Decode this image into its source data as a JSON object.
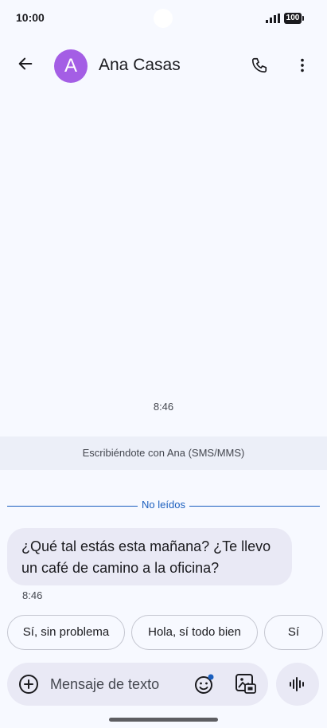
{
  "status_bar": {
    "time": "10:00",
    "battery": "100"
  },
  "header": {
    "avatar_letter": "A",
    "contact_name": "Ana Casas"
  },
  "conversation": {
    "timestamp": "8:46",
    "sms_notice": "Escribiéndote con Ana (SMS/MMS)",
    "unread_label": "No leídos",
    "message": {
      "line1": "¿Qué tal estás esta mañana? ¿Te llevo",
      "line2": "un café de camino a la oficina?",
      "time": "8:46"
    }
  },
  "smart_replies": [
    "Sí, sin problema",
    "Hola, sí todo bien",
    "Sí"
  ],
  "compose": {
    "placeholder": "Mensaje de texto"
  },
  "colors": {
    "accent": "#1a5ebe",
    "avatar": "#a45ee5",
    "bubble": "#e9e9f5",
    "background": "#f7f9ff"
  },
  "icons": [
    "back-arrow-icon",
    "phone-icon",
    "more-vert-icon",
    "add-circle-icon",
    "emoji-icon",
    "gallery-icon",
    "voice-icon",
    "signal-icon",
    "battery-icon"
  ]
}
